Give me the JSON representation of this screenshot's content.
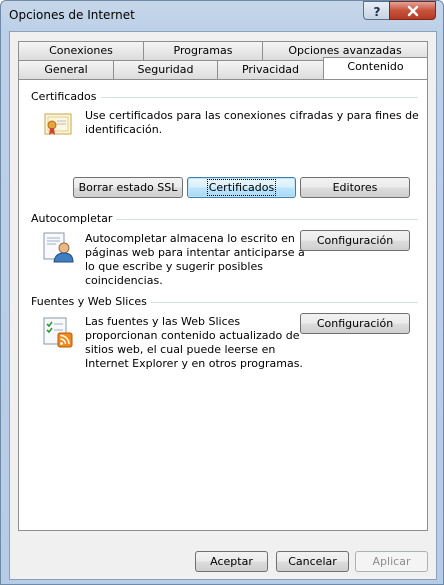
{
  "window": {
    "title": "Opciones de Internet"
  },
  "tabs": {
    "row_back": [
      "Conexiones",
      "Programas",
      "Opciones avanzadas"
    ],
    "row_front": [
      "General",
      "Seguridad",
      "Privacidad",
      "Contenido"
    ],
    "active": "Contenido"
  },
  "certificados": {
    "title": "Certificados",
    "description_line1": "Use certificados para las conexiones cifradas y para fines de",
    "description_line2": "identificación.",
    "btn_clear_ssl": "Borrar estado SSL",
    "btn_certificates": "Certificados",
    "btn_publishers": "Editores"
  },
  "autocompletar": {
    "title": "Autocompletar",
    "description_lines": [
      "Autocompletar almacena lo escrito en",
      "páginas web para intentar anticiparse a",
      "lo que escribe y sugerir posibles",
      "coincidencias."
    ],
    "btn_settings": "Configuración"
  },
  "fuentes": {
    "title": "Fuentes y Web Slices",
    "description_lines": [
      "Las fuentes y las Web Slices",
      "proporcionan contenido actualizado de",
      "sitios web, el cual puede leerse en",
      "Internet Explorer y en otros programas."
    ],
    "btn_settings": "Configuración"
  },
  "footer": {
    "ok": "Aceptar",
    "cancel": "Cancelar",
    "apply": "Aplicar"
  },
  "icons": {
    "help": "question-mark-icon",
    "close": "close-x-icon",
    "certificates": "certificate-icon",
    "autocomplete": "autocomplete-user-icon",
    "feeds": "feeds-rss-icon"
  }
}
